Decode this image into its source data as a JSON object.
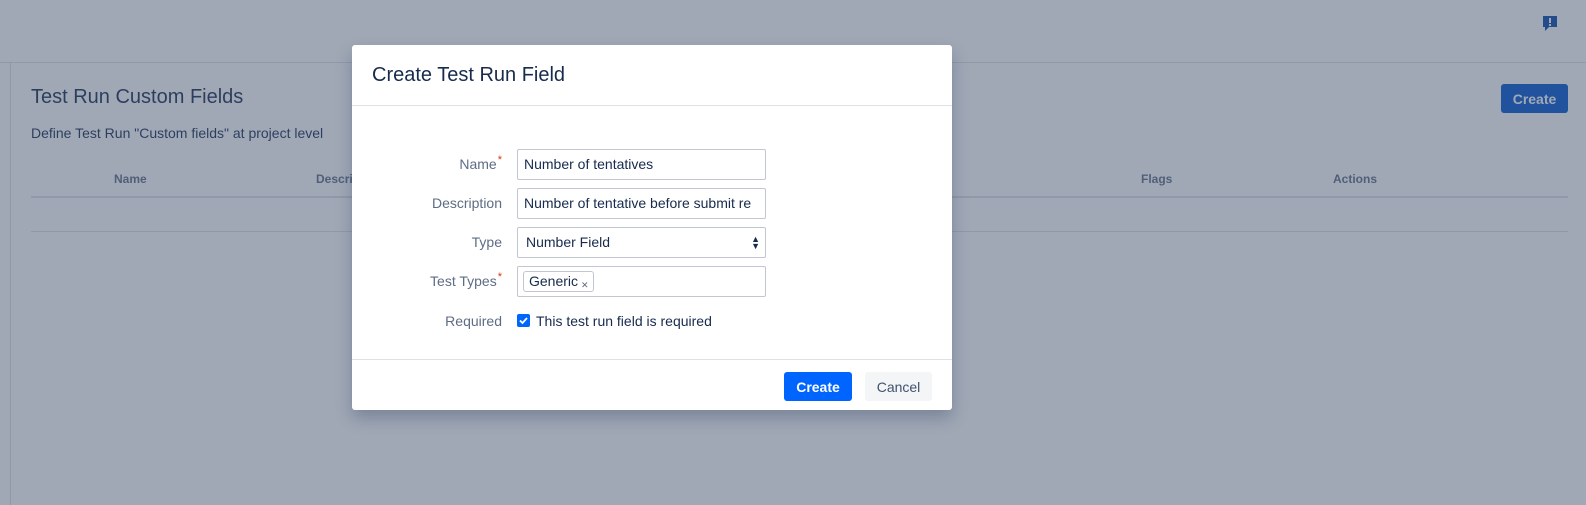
{
  "page": {
    "title": "Test Run Custom Fields",
    "subtitle": "Define Test Run \"Custom fields\" at project level",
    "create_label": "Create",
    "table": {
      "columns": [
        "Name",
        "Descri",
        "Flags",
        "Actions"
      ]
    }
  },
  "dialog": {
    "title": "Create Test Run Field",
    "fields": {
      "name": {
        "label": "Name",
        "value": "Number of tentatives",
        "required": true
      },
      "description": {
        "label": "Description",
        "value": "Number of tentative before submit re"
      },
      "type": {
        "label": "Type",
        "value": "Number Field"
      },
      "test_types": {
        "label": "Test Types",
        "tags": [
          "Generic"
        ],
        "required": true
      },
      "required": {
        "label": "Required",
        "checkbox_label": "This test run field is required",
        "checked": true
      }
    },
    "required_marker": "*",
    "buttons": {
      "create": "Create",
      "cancel": "Cancel"
    }
  },
  "icons": {
    "feedback": "feedback-icon",
    "select_arrows": "select-arrows-icon",
    "tag_remove": "tag-remove-icon",
    "check": "check-icon"
  },
  "colors": {
    "primary": "#0052cc",
    "dialog_primary": "#0065ff",
    "required": "#de350b"
  }
}
